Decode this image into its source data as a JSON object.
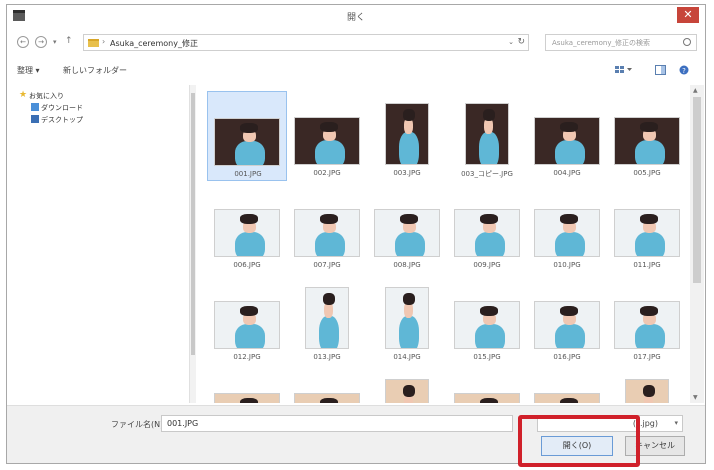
{
  "window": {
    "title": "開く",
    "close_glyph": "✕"
  },
  "address": {
    "back_glyph": "←",
    "forward_glyph": "→",
    "recent_glyph": "▾",
    "up_glyph": "↑",
    "path_sep": "›",
    "path": "Asuka_ceremony_修正",
    "path_drop": "⌄",
    "refresh_glyph": "↻",
    "search_placeholder": "Asuka_ceremony_修正の検索"
  },
  "toolbar": {
    "organize": "整理 ▾",
    "new_folder": "新しいフォルダー"
  },
  "nav_pane": {
    "items": [
      {
        "label": "お気に入り",
        "icon": "star-icon"
      },
      {
        "label": "ダウンロード",
        "icon": "download-folder-icon"
      },
      {
        "label": "デスクトップ",
        "icon": "desktop-icon"
      }
    ]
  },
  "files": [
    {
      "name": "001.JPG",
      "orient": "land",
      "bg": "dark",
      "selected": true
    },
    {
      "name": "002.JPG",
      "orient": "land",
      "bg": "dark"
    },
    {
      "name": "003.JPG",
      "orient": "port",
      "bg": "dark"
    },
    {
      "name": "003_コピー.JPG",
      "orient": "port",
      "bg": "dark"
    },
    {
      "name": "004.JPG",
      "orient": "land",
      "bg": "dark"
    },
    {
      "name": "005.JPG",
      "orient": "land",
      "bg": "dark"
    },
    {
      "name": "006.JPG",
      "orient": "land",
      "bg": "light"
    },
    {
      "name": "007.JPG",
      "orient": "land",
      "bg": "light"
    },
    {
      "name": "008.JPG",
      "orient": "land",
      "bg": "light"
    },
    {
      "name": "009.JPG",
      "orient": "land",
      "bg": "light"
    },
    {
      "name": "010.JPG",
      "orient": "land",
      "bg": "light"
    },
    {
      "name": "011.JPG",
      "orient": "land",
      "bg": "light"
    },
    {
      "name": "012.JPG",
      "orient": "land",
      "bg": "light"
    },
    {
      "name": "013.JPG",
      "orient": "port",
      "bg": "light"
    },
    {
      "name": "014.JPG",
      "orient": "port",
      "bg": "light"
    },
    {
      "name": "015.JPG",
      "orient": "land",
      "bg": "light"
    },
    {
      "name": "016.JPG",
      "orient": "land",
      "bg": "light"
    },
    {
      "name": "017.JPG",
      "orient": "land",
      "bg": "light"
    },
    {
      "name": "",
      "orient": "land",
      "bg": "warm"
    },
    {
      "name": "",
      "orient": "land",
      "bg": "warm"
    },
    {
      "name": "",
      "orient": "port",
      "bg": "warm"
    },
    {
      "name": "",
      "orient": "land",
      "bg": "warm"
    },
    {
      "name": "",
      "orient": "land",
      "bg": "warm"
    },
    {
      "name": "",
      "orient": "port",
      "bg": "warm"
    }
  ],
  "bottom": {
    "filename_label": "ファイル名(N):",
    "filename_value": "001.JPG",
    "filetype_value": "(*.jpg)",
    "open_label": "開く(O)",
    "cancel_label": "キャンセル"
  },
  "colors": {
    "selection_bg": "#d9e8fb",
    "highlight_border": "#d0202a",
    "close_button": "#c7453a",
    "kimono": "#5fb7d6",
    "hair": "#2a1f1e",
    "skin": "#f0c7b2",
    "dark_bg": "#3a2825",
    "light_bg": "#eef2f4",
    "warm_bg": "#e9cdb3"
  }
}
